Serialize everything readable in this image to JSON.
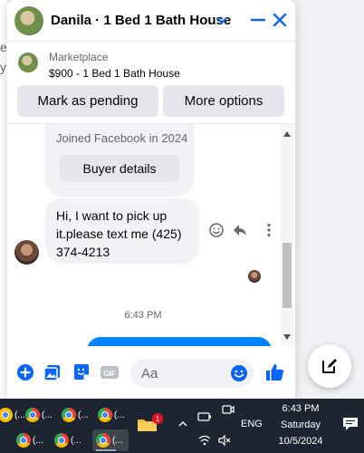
{
  "chat": {
    "title": "Danila · 1 Bed 1 Bath House",
    "listing": {
      "label": "Marketplace",
      "title": "$900 - 1 Bed 1 Bath House"
    },
    "actions": {
      "mark_pending": "Mark as pending",
      "more_options": "More options"
    },
    "profile_card": {
      "joined": "Joined Facebook in 2024",
      "buyer_details": "Buyer details"
    },
    "message": {
      "text": "Hi, I want to pick up it.please text me (425) 374-4213"
    },
    "timestamp": "6:43 PM",
    "composer": {
      "placeholder": "Aa"
    },
    "colors": {
      "accent": "#0084ff",
      "bubble": "#f0f2f5"
    }
  },
  "taskbar": {
    "apps": [
      {
        "label": "(..."
      },
      {
        "label": "(..."
      },
      {
        "label": "(..."
      },
      {
        "label": "(..."
      },
      {
        "label": "(..."
      },
      {
        "label": "(..."
      },
      {
        "label": "(..."
      }
    ],
    "badge_count": "1",
    "language": "ENG",
    "time": "6:43 PM",
    "day": "Saturday",
    "date": "10/5/2024"
  }
}
